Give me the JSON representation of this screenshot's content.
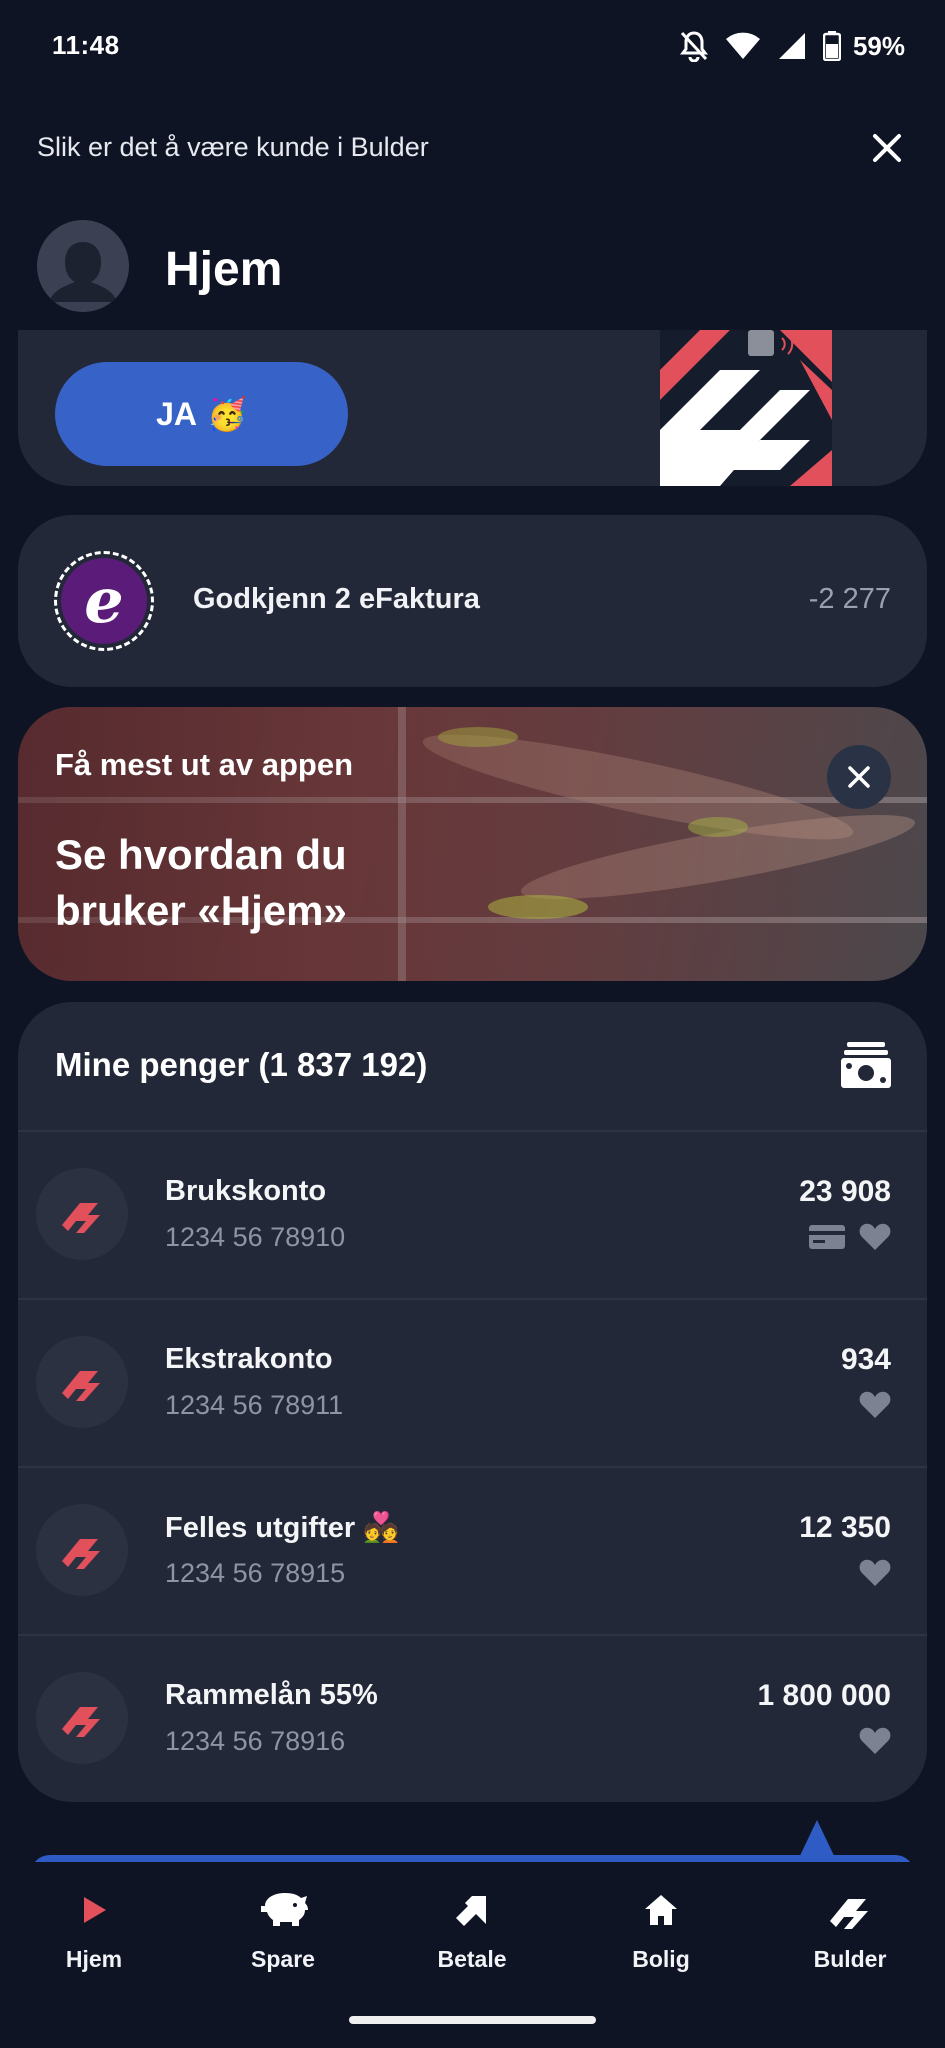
{
  "status_bar": {
    "time": "11:48",
    "battery": "59%"
  },
  "banner": {
    "text": "Slik er det å være kunde i Bulder"
  },
  "header": {
    "title": "Hjem"
  },
  "promo": {
    "button_label": "JA",
    "button_emoji": "🥳"
  },
  "efaktura": {
    "label": "Godkjenn 2 eFaktura",
    "amount": "-2 277",
    "logo_letter": "e"
  },
  "tip": {
    "kicker": "Få mest ut av appen",
    "title": "Se hvordan du bruker «Hjem»"
  },
  "accounts": {
    "title": "Mine penger (1 837 192)",
    "items": [
      {
        "name": "Brukskonto",
        "number": "1234 56 78910",
        "balance": "23 908",
        "has_card": true
      },
      {
        "name": "Ekstrakonto",
        "number": "1234 56 78911",
        "balance": "934",
        "has_card": false
      },
      {
        "name": "Felles utgifter 💑",
        "number": "1234 56 78915",
        "balance": "12 350",
        "has_card": false
      },
      {
        "name": "Rammelån 55%",
        "number": "1234 56 78916",
        "balance": "1 800 000",
        "has_card": false
      }
    ]
  },
  "nav": {
    "items": [
      {
        "label": "Hjem",
        "icon": "play-icon",
        "active": true
      },
      {
        "label": "Spare",
        "icon": "piggy-bank-icon"
      },
      {
        "label": "Betale",
        "icon": "transfer-arrow-icon"
      },
      {
        "label": "Bolig",
        "icon": "house-icon"
      },
      {
        "label": "Bulder",
        "icon": "bulder-logo-icon"
      }
    ]
  },
  "colors": {
    "background": "#0e1424",
    "card": "#232838",
    "accent_blue": "#3763c9",
    "brand_red": "#e2505c",
    "efaktura_purple": "#5b1b79"
  }
}
